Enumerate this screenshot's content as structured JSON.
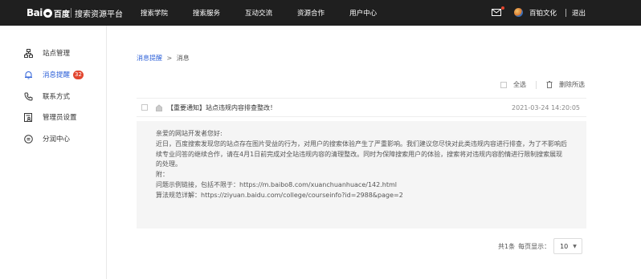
{
  "header": {
    "logo_text": "Bai",
    "logo_du": "百度",
    "platform": "搜索资源平台",
    "nav": [
      "搜索学院",
      "搜索服务",
      "互动交流",
      "资源合作",
      "用户中心"
    ],
    "username": "百铂文化",
    "logout": "退出"
  },
  "sidebar": {
    "items": [
      {
        "label": "站点管理",
        "icon": "sitemap-icon"
      },
      {
        "label": "消息提醒",
        "icon": "bell-icon",
        "badge": "32"
      },
      {
        "label": "联系方式",
        "icon": "phone-icon"
      },
      {
        "label": "管理员设置",
        "icon": "admin-icon"
      },
      {
        "label": "分润中心",
        "icon": "coin-icon"
      }
    ]
  },
  "breadcrumb": {
    "link": "消息提醒",
    "sep": ">",
    "current": "消息"
  },
  "actions": {
    "select_all": "全选",
    "delete_selected": "删除所选"
  },
  "message": {
    "title": "【重要通知】站点违规内容排查整改！",
    "time": "2021-03-24 14:20:05",
    "body": [
      "亲爱的网站开发者您好:",
      "近日，百度搜索发现您的站点存在图片受益的行为，对用户的搜索体验产生了严重影响。我们建议您尽快对此类违规内容进行排查，为了不影响后",
      "续专业问答的继续合作，请在4月1日前完成对全站违规内容的清理整改。同时为保障搜索用户的体验，搜索将对违规内容酌情进行限制搜索展现",
      "的处理。",
      "附：",
      "问题示例链接，包括不限于：https://m.baibo8.com/xuanchuanhuace/142.html",
      "算法规范详解：https://ziyuan.baidu.com/college/courseinfo?id=2988&page=2"
    ]
  },
  "pager": {
    "total": "共1条",
    "per_page_label": "每页显示：",
    "per_page": "10"
  },
  "colors": {
    "topbar": "#1f1f1f",
    "accent": "#2e61d8",
    "badge": "#e2462f",
    "body_bg": "#f5f5f5"
  }
}
